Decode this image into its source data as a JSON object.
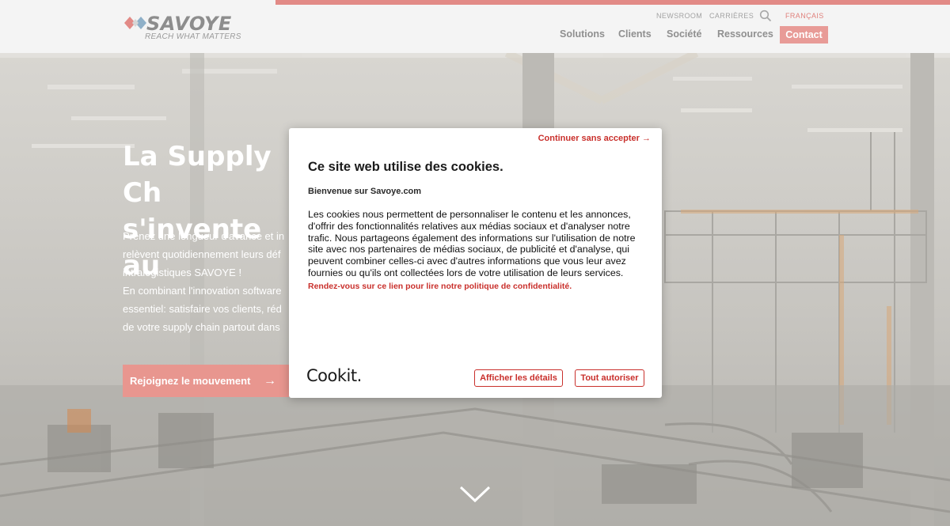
{
  "header": {
    "logo": {
      "wordmark": "SAVOYE",
      "tagline": "REACH WHAT MATTERS"
    },
    "top_links": {
      "newsroom": "NEWSROOM",
      "careers": "CARRIÈRES",
      "language": "FRANÇAIS"
    },
    "nav": {
      "solutions": "Solutions",
      "clients": "Clients",
      "societe": "Société",
      "ressources": "Ressources",
      "contact": "Contact"
    },
    "colors": {
      "accent": "#e28a86",
      "contact_bg": "#e89b97"
    }
  },
  "hero": {
    "title": "La Supply Ch\ns'invente au",
    "paragraph_lines": [
      "Prenez une longueur d'avance et in",
      "relèvent quotidiennement leurs déf",
      "intralogistiques SAVOYE !",
      "En combinant l'innovation software",
      "essentiel: satisfaire vos clients, réd",
      "de votre supply chain partout dans"
    ],
    "cta_label": "Rejoignez le mouvement",
    "cta_arrow": "→"
  },
  "cookie_dialog": {
    "continue_link": "Continuer sans accepter →",
    "title": "Ce site web utilise des cookies.",
    "welcome": "Bienvenue sur Savoye.com",
    "body": "Les cookies nous permettent de personnaliser le contenu et les annonces, d'offrir des fonctionnalités relatives aux médias sociaux et d'analyser notre trafic. Nous partageons également des informations sur l'utilisation de notre site avec nos partenaires de médias sociaux, de publicité et d'analyse, qui peuvent combiner celles-ci avec d'autres informations que vous leur avez fournies ou qu'ils ont collectées lors de votre utilisation de leurs services.",
    "policy_link": "Rendez-vous sur ce lien pour lire notre politique de confidentialité.",
    "brand": "Cookit.",
    "details_button": "Afficher les détails",
    "accept_button": "Tout autoriser",
    "colors": {
      "link": "#c9302c"
    }
  }
}
